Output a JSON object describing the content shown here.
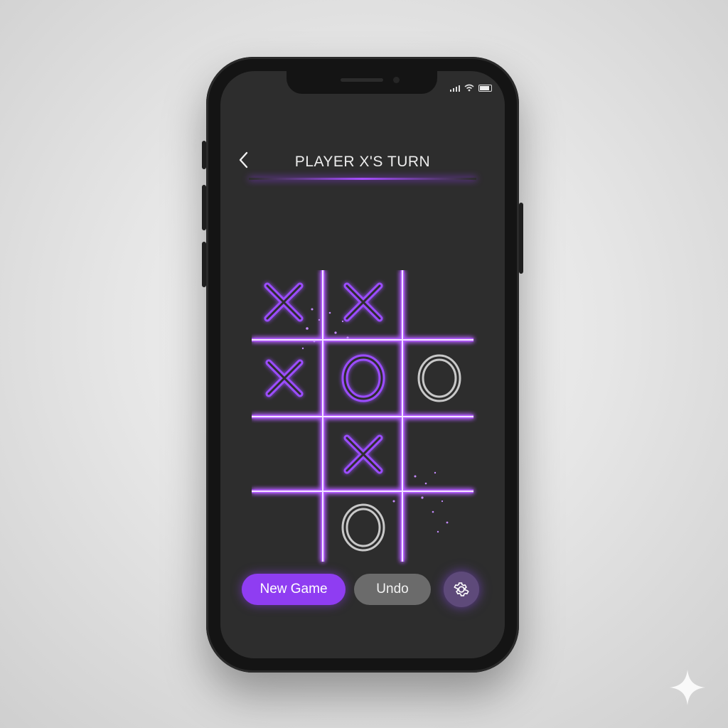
{
  "header": {
    "back_icon": "chevron-left-icon",
    "title": "PLAYER X'S TURN"
  },
  "status_bar": {
    "icons": [
      "signal-icon",
      "wifi-icon",
      "battery-icon"
    ]
  },
  "board": {
    "cells": [
      {
        "mark": "X",
        "style": "glow"
      },
      {
        "mark": "X",
        "style": "glow"
      },
      {
        "mark": "",
        "style": ""
      },
      {
        "mark": "X",
        "style": "glow"
      },
      {
        "mark": "O",
        "style": "glow"
      },
      {
        "mark": "O",
        "style": "plain"
      },
      {
        "mark": "",
        "style": ""
      },
      {
        "mark": "X",
        "style": "glow"
      },
      {
        "mark": "",
        "style": ""
      },
      {
        "mark": "",
        "style": ""
      },
      {
        "mark": "O",
        "style": "plain"
      },
      {
        "mark": "",
        "style": ""
      }
    ]
  },
  "actions": {
    "new_game_label": "New Game",
    "undo_label": "Undo",
    "settings_icon": "gear-icon"
  },
  "colors": {
    "accent": "#a64dff",
    "screen_bg": "#2d2d2d",
    "plain_mark": "#c8c8c8"
  }
}
